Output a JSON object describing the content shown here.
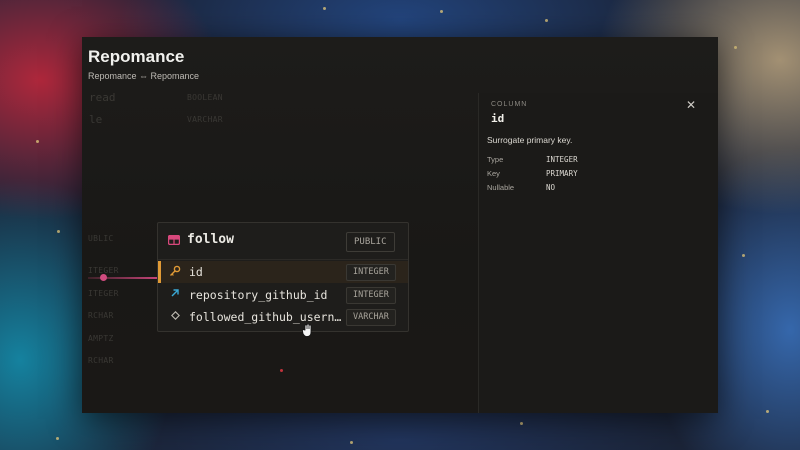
{
  "window": {
    "title": "Repomance",
    "breadcrumb": "Repomance ⇔ Repomance"
  },
  "background_columns": [
    {
      "name": "read",
      "type": "BOOLEAN"
    },
    {
      "name": "le",
      "type": "VARCHAR"
    }
  ],
  "background_fragments": [
    "UBLIC",
    "ITEGER",
    "ITEGER",
    "RCHAR",
    "AMPTZ",
    "RCHAR"
  ],
  "table": {
    "name": "follow",
    "schema": "PUBLIC",
    "icon": "table-icon",
    "columns": [
      {
        "name": "id",
        "type": "INTEGER",
        "icon": "key-icon",
        "selected": true
      },
      {
        "name": "repository_github_id",
        "type": "INTEGER",
        "icon": "arrow-up-right-icon",
        "selected": false
      },
      {
        "name": "followed_github_usern…",
        "type": "VARCHAR",
        "icon": "diamond-icon",
        "selected": false
      }
    ]
  },
  "panel": {
    "kicker": "COLUMN",
    "column_name": "id",
    "description": "Surrogate primary key.",
    "props": [
      {
        "label": "Type",
        "value": "INTEGER"
      },
      {
        "label": "Key",
        "value": "PRIMARY"
      },
      {
        "label": "Nullable",
        "value": "NO"
      }
    ]
  },
  "colors": {
    "key_icon": "#e09a36",
    "fk_icon": "#3aa9d6",
    "table_icon": "#d8487c",
    "edge": "#c64478"
  }
}
